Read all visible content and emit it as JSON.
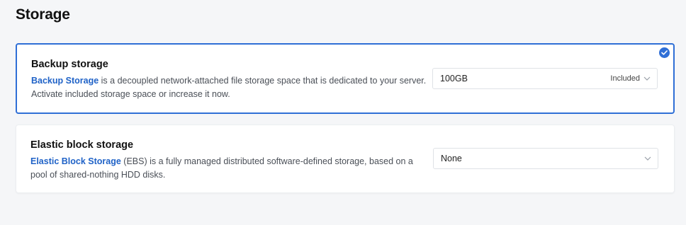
{
  "page": {
    "title": "Storage"
  },
  "backup": {
    "title": "Backup storage",
    "link_text": "Backup Storage",
    "description_rest": " is a decoupled network-attached file storage space that is dedicated to your server. Activate included storage space or increase it now.",
    "select_value": "100GB",
    "select_badge": "Included",
    "selected": true
  },
  "elastic": {
    "title": "Elastic block storage",
    "link_text": "Elastic Block Storage",
    "description_rest": " (EBS) is a fully managed distributed software-defined storage, based on a pool of shared-nothing HDD disks.",
    "select_value": "None"
  },
  "colors": {
    "accent": "#2f6fd6",
    "link": "#1f62c7"
  },
  "icons": {
    "selected": "check-circle-icon",
    "dropdown": "chevron-down-icon"
  }
}
